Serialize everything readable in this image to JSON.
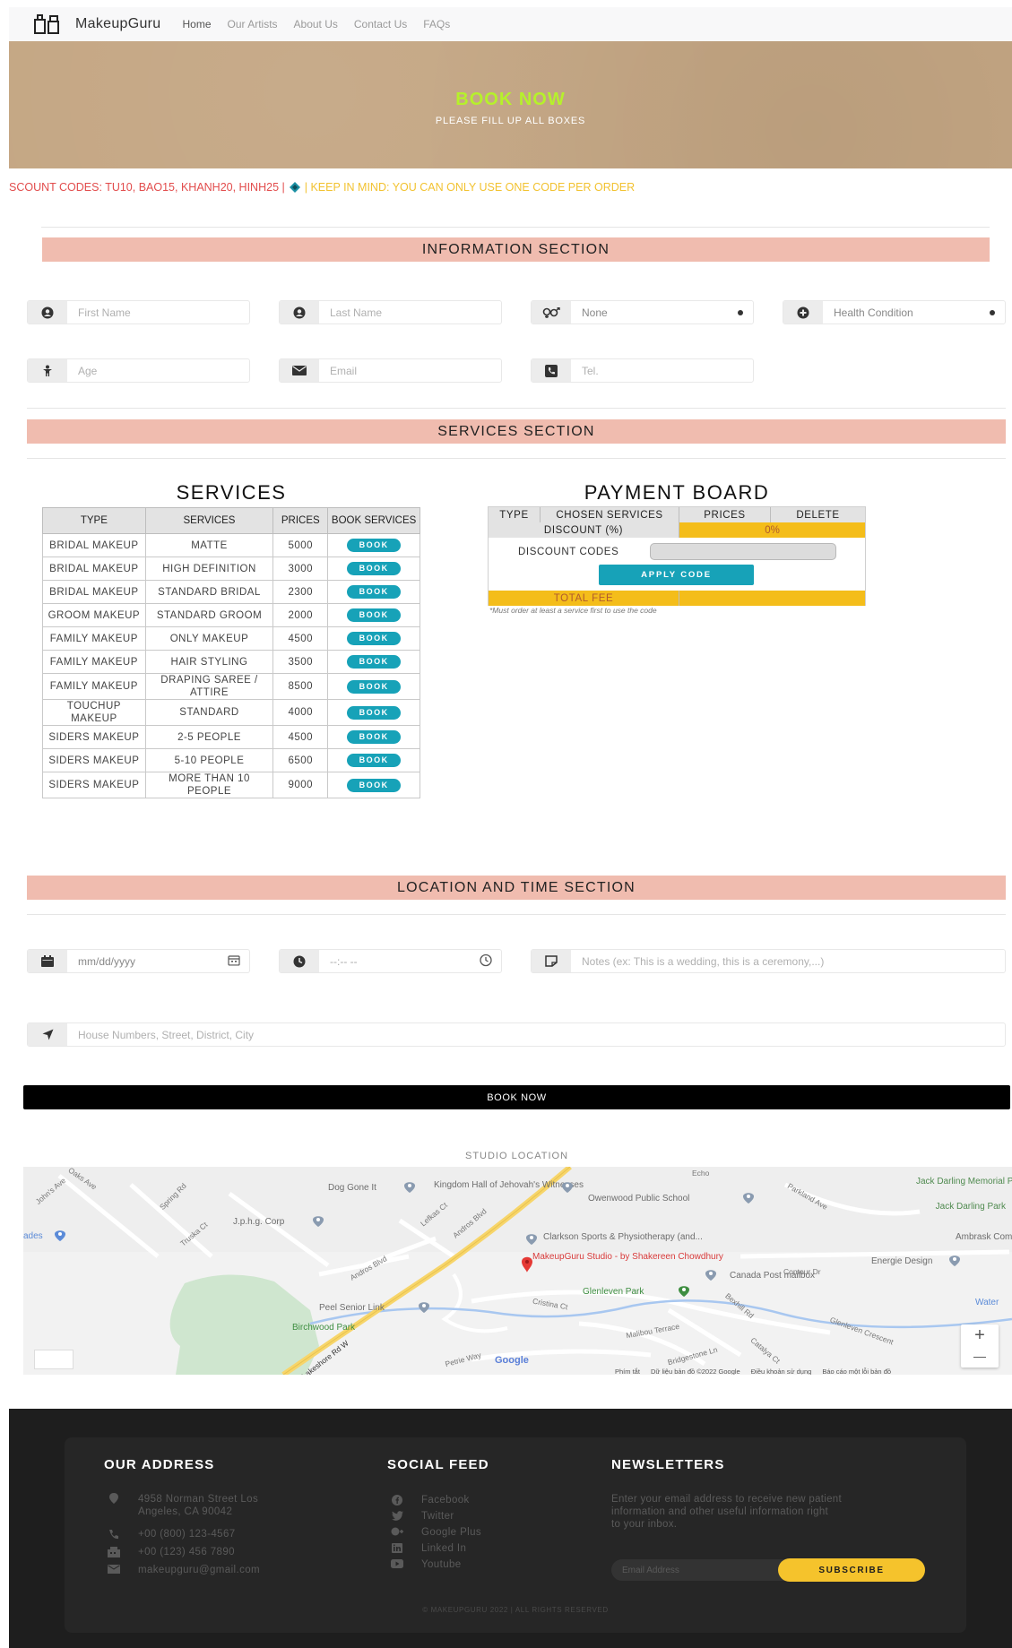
{
  "nav": {
    "brand": "MakeupGuru",
    "links": [
      "Home",
      "Our Artists",
      "About Us",
      "Contact Us",
      "FAQs"
    ]
  },
  "hero": {
    "title": "BOOK NOW",
    "subtitle": "PLEASE FILL UP ALL BOXES"
  },
  "marquee": {
    "codes_text": "SCOUNT CODES: TU10, BAO15, KHANH20, HINH25 |",
    "note_text": "| KEEP IN MIND: YOU CAN ONLY USE ONE CODE PER ORDER"
  },
  "info_section": {
    "title": "INFORMATION SECTION",
    "first_name_placeholder": "First Name",
    "last_name_placeholder": "Last Name",
    "gender_value": "None",
    "health_value": "Health Condition",
    "age_placeholder": "Age",
    "email_placeholder": "Email",
    "tel_placeholder": "Tel."
  },
  "services_section": {
    "title": "SERVICES SECTION",
    "table_title": "SERVICES",
    "headers": [
      "TYPE",
      "SERVICES",
      "PRICES",
      "BOOK SERVICES"
    ],
    "book_label": "BOOK",
    "rows": [
      {
        "type": "BRIDAL MAKEUP",
        "service": "MATTE",
        "price": "5000"
      },
      {
        "type": "BRIDAL MAKEUP",
        "service": "HIGH DEFINITION",
        "price": "3000"
      },
      {
        "type": "BRIDAL MAKEUP",
        "service": "STANDARD BRIDAL",
        "price": "2300"
      },
      {
        "type": "GROOM MAKEUP",
        "service": "STANDARD GROOM",
        "price": "2000"
      },
      {
        "type": "FAMILY MAKEUP",
        "service": "ONLY MAKEUP",
        "price": "4500"
      },
      {
        "type": "FAMILY MAKEUP",
        "service": "HAIR STYLING",
        "price": "3500"
      },
      {
        "type": "FAMILY MAKEUP",
        "service": "DRAPING SAREE / ATTIRE",
        "price": "8500"
      },
      {
        "type": "TOUCHUP MAKEUP",
        "service": "STANDARD",
        "price": "4000"
      },
      {
        "type": "SIDERS MAKEUP",
        "service": "2-5 PEOPLE",
        "price": "4500"
      },
      {
        "type": "SIDERS MAKEUP",
        "service": "5-10 PEOPLE",
        "price": "6500"
      },
      {
        "type": "SIDERS MAKEUP",
        "service": "MORE THAN 10 PEOPLE",
        "price": "9000"
      }
    ]
  },
  "payment": {
    "title": "PAYMENT BOARD",
    "headers": [
      "TYPE",
      "CHOSEN SERVICES",
      "PRICES",
      "DELETE"
    ],
    "discount_label": "DISCOUNT (%)",
    "discount_value": "0%",
    "discount_codes_label": "DISCOUNT CODES",
    "apply_label": "APPLY CODE",
    "total_label": "TOTAL FEE",
    "note": "*Must order at least a service first to use the code"
  },
  "location_section": {
    "title": "LOCATION AND TIME SECTION",
    "date_placeholder": "mm/dd/yyyy",
    "time_placeholder": "--:-- --",
    "notes_placeholder": "Notes (ex: This is a wedding, this is a ceremony,...)",
    "address_placeholder": "House Numbers, Street, District, City"
  },
  "book_button": "BOOK NOW",
  "map": {
    "caption": "STUDIO LOCATION",
    "labels": {
      "dog_gone": "Dog Gone It",
      "kingdom": "Kingdom Hall of Jehovah's Witnesses",
      "ownwood": "Owenwood Public School",
      "jack": "Jack Darling Memorial Park",
      "jack2": "Jack Darling Park",
      "jphg": "J.p.h.g. Corp",
      "clarkson": "Clarkson Sports & Physiotherapy (and...",
      "studio": "MakeupGuru Studio - by Shakereen Chowdhury",
      "energie": "Energie Design",
      "canada": "Canada Post mailbox",
      "glenleven_park": "Glenleven Park",
      "peel": "Peel Senior Link",
      "birchwood": "Birchwood Park",
      "ambrask": "Ambrask Compan",
      "water": "Water",
      "ades": "ades"
    },
    "roads": [
      "Oaks Ave",
      "John's Ave",
      "Spring Rd",
      "Truska Ct",
      "Lefkas Ct",
      "Andros Blvd",
      "Andros Blvd",
      "Parkland Ave",
      "Contour Dr",
      "Cristina Ct",
      "Bexhill Rd",
      "Malibou Terrace",
      "Glenleven Crescent",
      "Bridgestone Ln",
      "Catalya Ct",
      "Petrie Way",
      "Lakeshore Rd W",
      "Echo"
    ],
    "google": "Google",
    "footer_links": [
      "Phím tắt",
      "Dữ liệu bản đồ ©2022 Google",
      "Điều khoản sử dụng",
      "Báo cáo một lỗi bản đồ"
    ],
    "zoom_in": "+",
    "zoom_out": "—"
  },
  "footer": {
    "address_title": "OUR ADDRESS",
    "address_line1": "4958 Norman Street Los",
    "address_line2": "Angeles, CA 90042",
    "phone1": "+00 (800) 123-4567",
    "phone2": "+00 (123) 456 7890",
    "email": "makeupguru@gmail.com",
    "social_title": "SOCIAL FEED",
    "social": [
      "Facebook",
      "Twitter",
      "Google Plus",
      "Linked In",
      "Youtube"
    ],
    "news_title": "NEWSLETTERS",
    "news_text_1": "Enter your email address to receive new patient",
    "news_text_2": "information and other useful information right",
    "news_text_3": "to your inbox.",
    "email_placeholder": "Email Address",
    "subscribe": "SUBSCRIBE",
    "copyright": "© MAKEUPGURU 2022 | ALL RIGHTS RESERVED"
  },
  "colors": {
    "accent_teal": "#17a2b8",
    "section_bar": "#f0bcaf",
    "hero_title": "#b6f12b",
    "subscribe_yellow": "#f5c32c"
  }
}
